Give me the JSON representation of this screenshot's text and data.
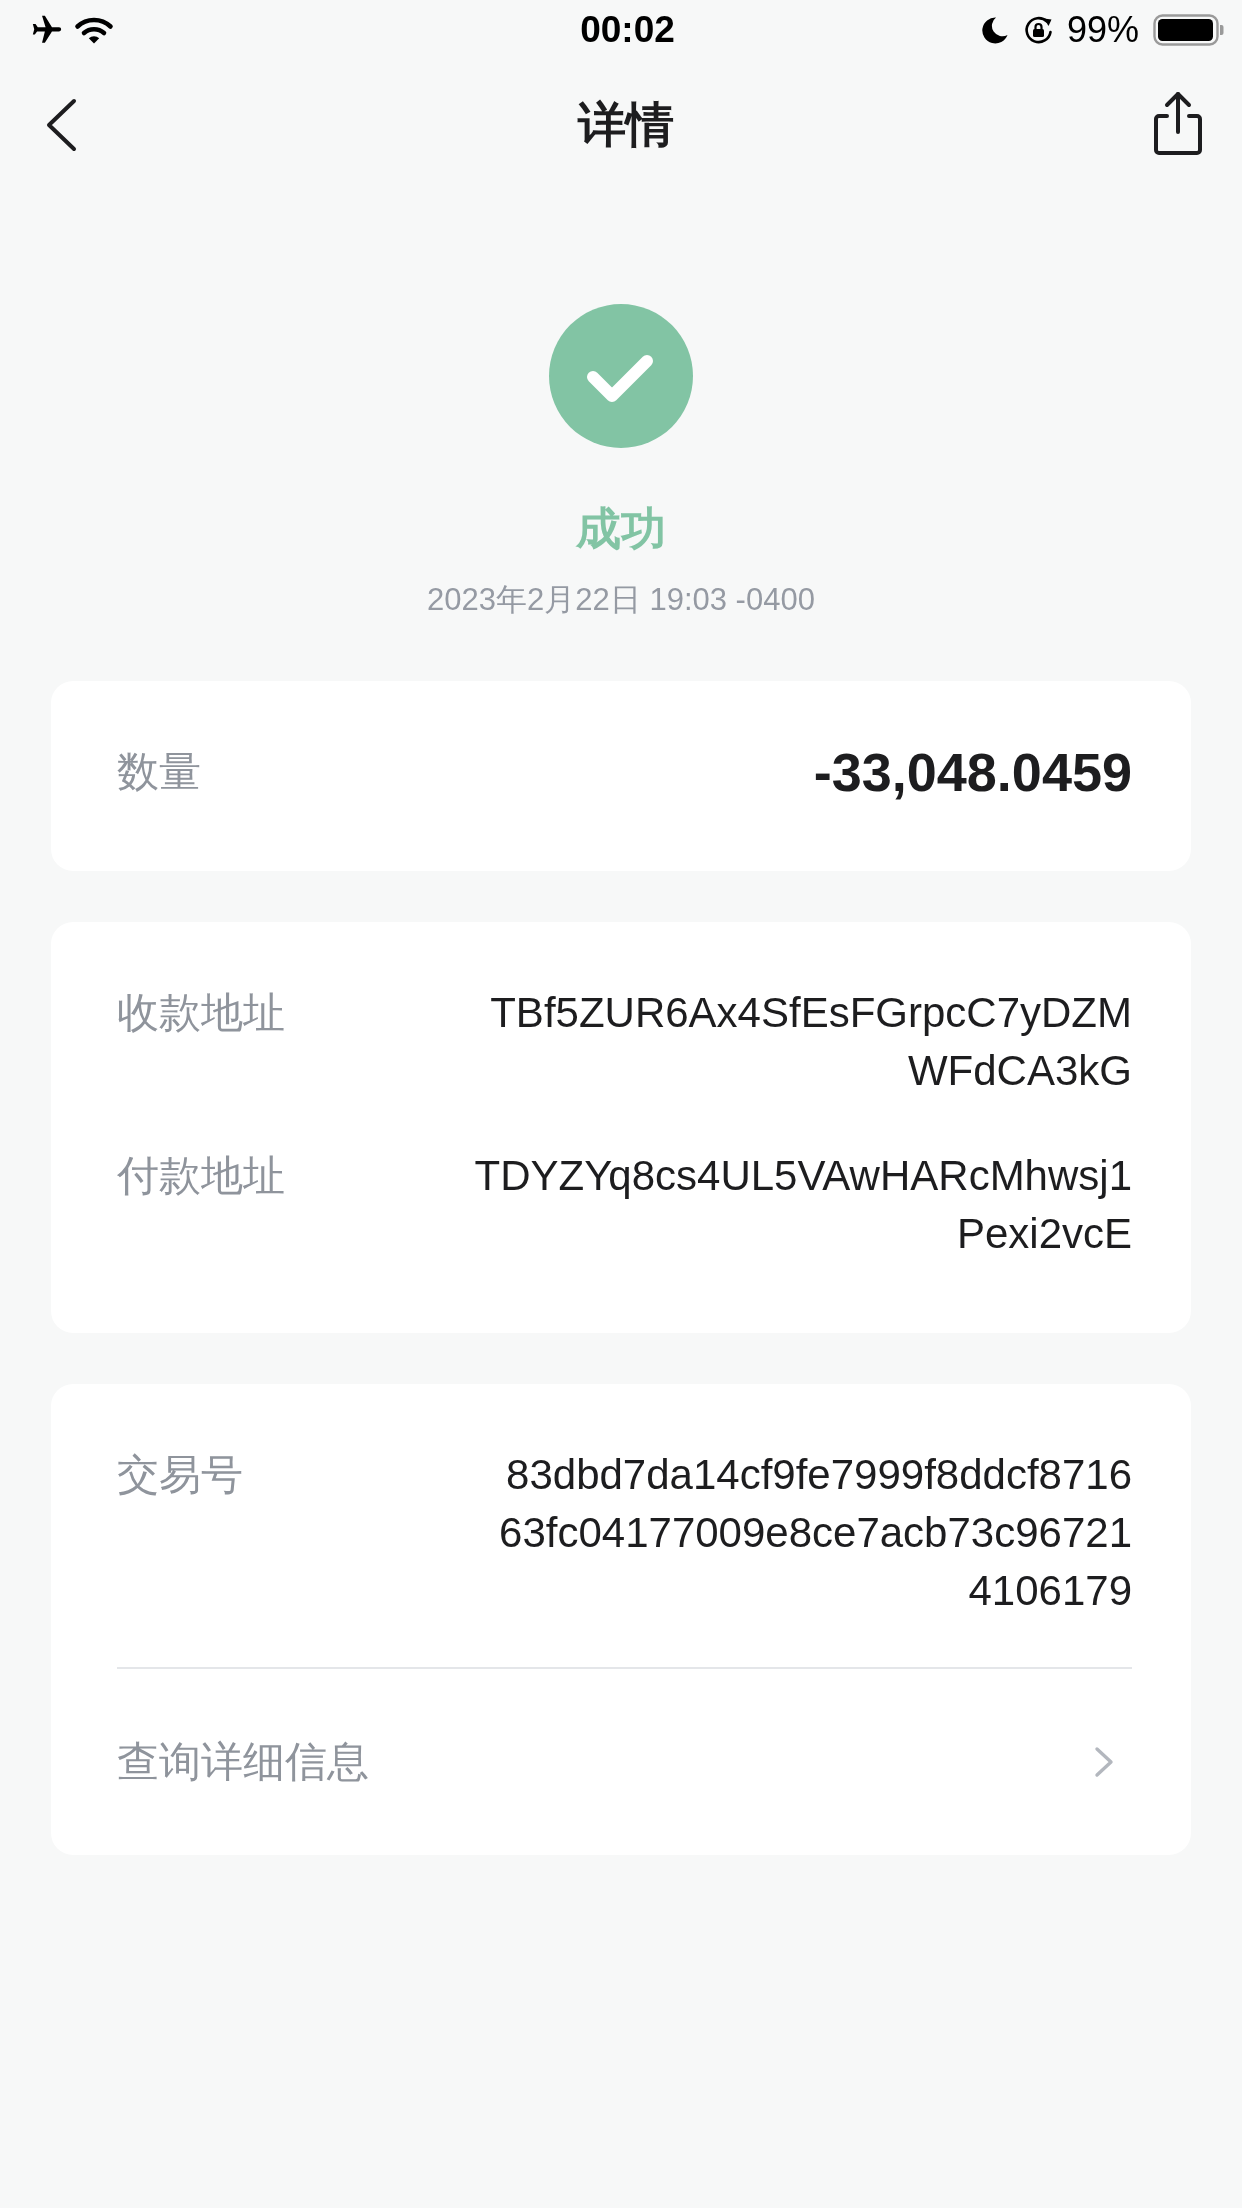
{
  "status_bar": {
    "time": "00:02",
    "battery": "99%"
  },
  "nav_bar": {
    "title": "详情"
  },
  "result": {
    "kind": "success",
    "status": "成功",
    "datetime": "2023年2月22日 19:03 -0400"
  },
  "cards": [
    {
      "rows": [
        {
          "kind": "amount",
          "label": "数量",
          "value_lines": [
            "-33,048.0459"
          ]
        }
      ]
    },
    {
      "rows": [
        {
          "kind": "text",
          "label": "收款地址",
          "value_lines": [
            "TBf5ZUR6Ax4SfEsFGrpcC7yDZM",
            "WFdCA3kG"
          ]
        },
        {
          "kind": "text",
          "label": "付款地址",
          "value_lines": [
            "TDYZYq8cs4UL5VAwHARcMhwsj1",
            "Pexi2vcE"
          ]
        }
      ]
    },
    {
      "rows": [
        {
          "kind": "text",
          "label": "交易号",
          "value_lines": [
            "83dbd7da14cf9fe7999f8ddcf8716",
            "63fc04177009e8ce7acb73c96721",
            "4106179"
          ]
        }
      ],
      "link": {
        "label": "查询详细信息"
      }
    }
  ]
}
